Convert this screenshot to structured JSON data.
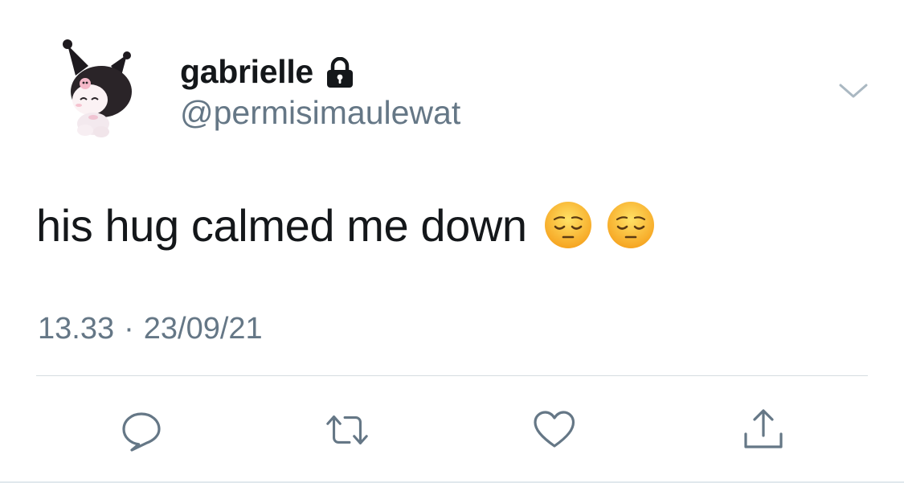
{
  "author": {
    "display_name": "gabrielle",
    "handle": "@permisimaulewat",
    "protected": true,
    "avatar": "kuromi-character-avatar"
  },
  "tweet": {
    "text": "his hug calmed me down",
    "emojis": [
      "pensive-face-emoji",
      "pensive-face-emoji"
    ],
    "time": "13.33",
    "separator": "·",
    "date": "23/09/21"
  },
  "actions": {
    "reply_icon": "reply-icon",
    "retweet_icon": "retweet-icon",
    "like_icon": "heart-icon",
    "share_icon": "share-icon",
    "menu_icon": "chevron-down-icon"
  },
  "colors": {
    "text_primary": "#14171a",
    "text_secondary": "#657786",
    "divider": "#d6dce0",
    "icon": "#657786"
  }
}
